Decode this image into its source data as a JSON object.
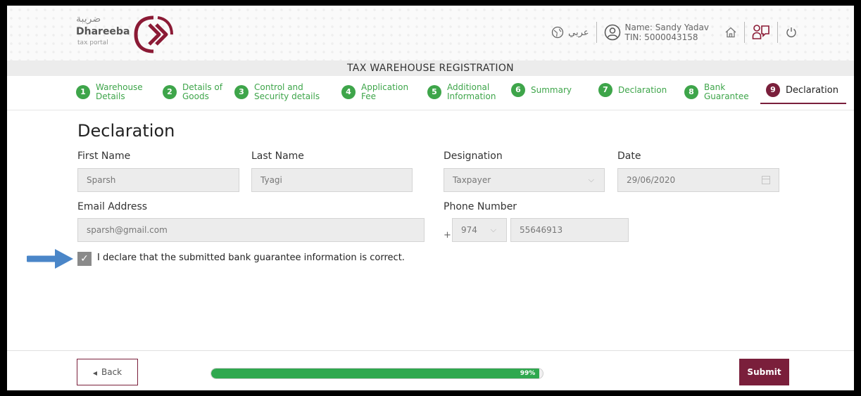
{
  "brand": {
    "name_ar": "ضريبة",
    "name_en": "Dhareeba",
    "tagline": "tax portal"
  },
  "header": {
    "language_label": "عربي",
    "user_name": "Name: Sandy Yadav",
    "user_tin": "TIN: 5000043158",
    "icons": [
      "globe-icon",
      "user-icon",
      "home-icon",
      "help-icon",
      "power-icon"
    ]
  },
  "page": {
    "banner_title": "TAX WAREHOUSE REGISTRATION",
    "title": "Declaration"
  },
  "steps": [
    {
      "number": "1",
      "label": "Warehouse Details",
      "state": "completed"
    },
    {
      "number": "2",
      "label": "Details of Goods",
      "state": "completed"
    },
    {
      "number": "3",
      "label": "Control and Security details",
      "state": "completed"
    },
    {
      "number": "4",
      "label": "Application Fee",
      "state": "completed"
    },
    {
      "number": "5",
      "label": "Additional Information",
      "state": "completed"
    },
    {
      "number": "6",
      "label": "Summary",
      "state": "completed"
    },
    {
      "number": "7",
      "label": "Declaration",
      "state": "completed"
    },
    {
      "number": "8",
      "label": "Bank Guarantee",
      "state": "completed"
    },
    {
      "number": "9",
      "label": "Declaration",
      "state": "active"
    }
  ],
  "form": {
    "first_name": {
      "label": "First Name",
      "value": "Sparsh"
    },
    "last_name": {
      "label": "Last Name",
      "value": "Tyagi"
    },
    "designation": {
      "label": "Designation",
      "value": "Taxpayer"
    },
    "date": {
      "label": "Date",
      "value": "29/06/2020"
    },
    "email": {
      "label": "Email Address",
      "value": "sparsh@gmail.com"
    },
    "phone": {
      "label": "Phone Number",
      "prefix": "+",
      "country_code": "974",
      "number": "55646913"
    },
    "declaration": {
      "checked": true,
      "text": "I declare that the submitted bank guarantee information is correct."
    }
  },
  "footer": {
    "back_label": "Back",
    "submit_label": "Submit",
    "progress_percent": 99,
    "progress_label": "99%"
  },
  "colors": {
    "brand": "#7a1f3b",
    "step_green": "#3ea54a",
    "progress_green": "#2fa84f",
    "annotation_arrow": "#4a86c8"
  }
}
